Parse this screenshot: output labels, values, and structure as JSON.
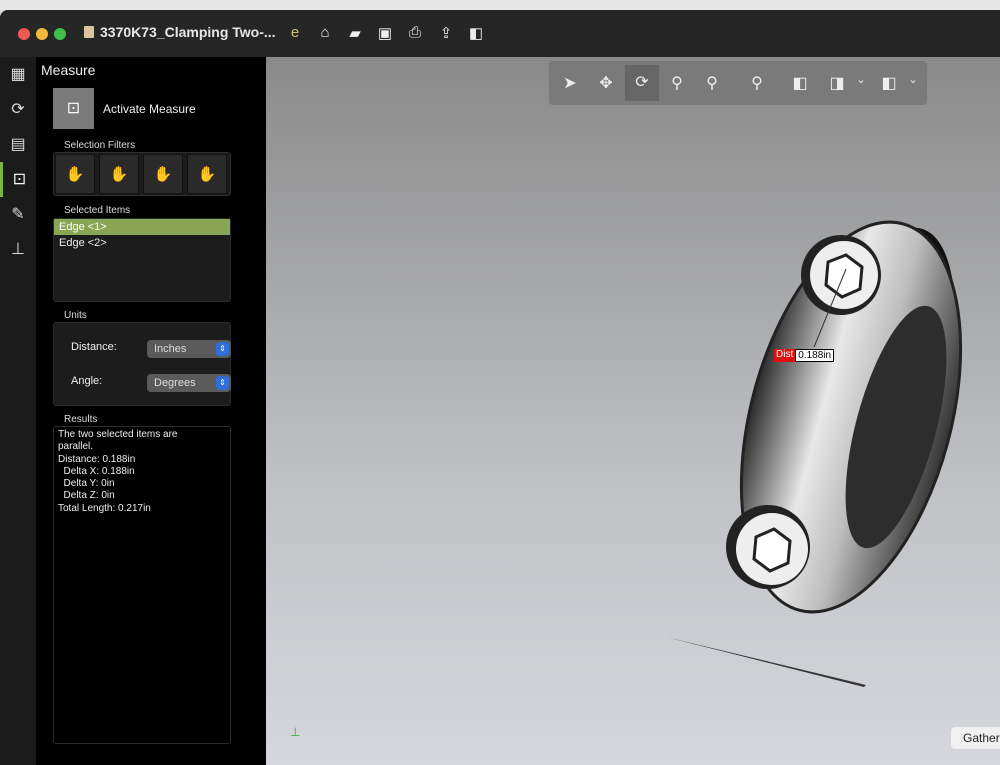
{
  "window": {
    "title": "3370K73_Clamping Two-...",
    "toolbar_icons": [
      "insert-e-icon",
      "home-icon",
      "open-folder-icon",
      "save-icon",
      "print-icon",
      "share-icon",
      "sidebar-toggle-icon"
    ]
  },
  "rail": [
    "grid-icon",
    "animation-icon",
    "parts-icon",
    "measure-icon",
    "markup-icon",
    "stamp-icon"
  ],
  "panel": {
    "title": "Measure",
    "activate_label": "Activate Measure",
    "selection_filters_label": "Selection Filters",
    "selected_items_label": "Selected Items",
    "selected_items": [
      {
        "label": "Edge <1>",
        "selected": true
      },
      {
        "label": "Edge <2>",
        "selected": false
      }
    ],
    "units_label": "Units",
    "distance_label": "Distance:",
    "distance_value": "Inches",
    "angle_label": "Angle:",
    "angle_value": "Degrees",
    "results_label": "Results",
    "results_text": "The two selected items are\nparallel.\nDistance: 0.188in\n  Delta X: 0.188in\n  Delta Y: 0in\n  Delta Z: 0in\nTotal Length: 0.217in"
  },
  "viewport": {
    "tools": [
      "select-icon",
      "pan-icon",
      "rotate-icon",
      "zoom-icon",
      "zoom-window-icon",
      "zoom-fit-icon",
      "box-view-icon",
      "section-view-icon",
      "shaded-view-icon"
    ],
    "dist_tag": "Dist",
    "dist_value": "0.188in",
    "gather_label": "Gather"
  }
}
